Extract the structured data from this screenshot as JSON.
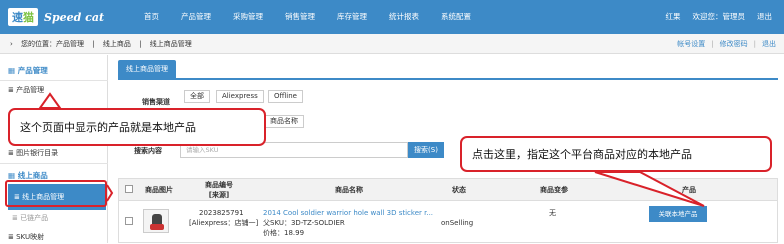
{
  "header": {
    "logo_mark": [
      "速",
      "猫"
    ],
    "logo_text": "Speed cat",
    "nav": [
      "首页",
      "产品管理",
      "采购管理",
      "销售管理",
      "库存管理",
      "统计报表",
      "系统配置"
    ],
    "user_links": [
      "红果",
      "欢迎您：管理员",
      "退出"
    ]
  },
  "breadcrumb": {
    "items": [
      "您的位置：产品管理",
      "线上商品",
      "线上商品管理"
    ],
    "right_links": [
      "帐号设置",
      "修改密码",
      "退出"
    ]
  },
  "sidebar": {
    "product_group": "产品管理",
    "product_item": "产品管理",
    "image_item": "图片银行目录",
    "online_group": "线上商品",
    "active_item": "线上商品管理",
    "partial_item": "已链产品",
    "sku_item": "SKU映射"
  },
  "main": {
    "tab": "线上商品管理",
    "channel_label": "销售渠道",
    "channels": [
      "全部",
      "Aliexpress",
      "Offline"
    ],
    "name_option": "商品名称",
    "search_label": "搜索内容",
    "search_placeholder": "请输入SKU",
    "search_button": "搜索(S)",
    "columns": [
      "商品图片",
      "商品编号",
      "[来源]",
      "商品名称",
      "状态",
      "商品变参",
      "产品"
    ],
    "row": {
      "id": "2023825791",
      "source": "[Aliexpress：店铺一]",
      "title": "2014 Cool soldier warrior hole wall 3D sticker r...",
      "parent_sku": "父SKU：3D-TZ-SOLDIER",
      "price": "价格：18.99",
      "status": "onSelling",
      "variant": "无",
      "action": "关联本地产品"
    }
  },
  "annotations": {
    "left": "这个页面中显示的产品就是本地产品",
    "right": "点击这里，指定这个平台商品对应的本地产品"
  },
  "colors": {
    "primary": "#3d8ac7",
    "annotation": "#d9222a"
  }
}
